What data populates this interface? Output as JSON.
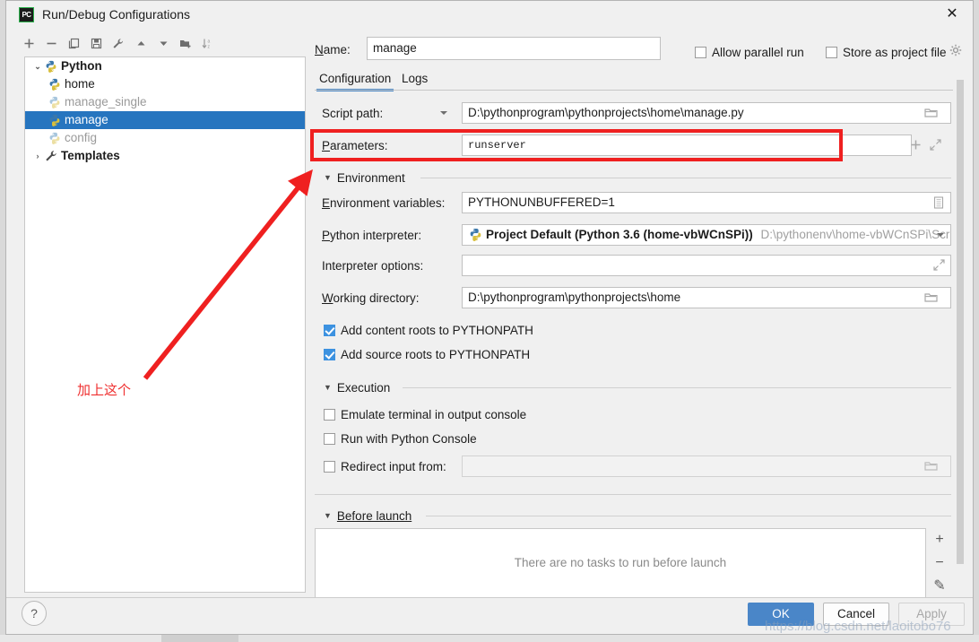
{
  "window": {
    "title": "Run/Debug Configurations",
    "app_icon": "pycharm-icon",
    "close_label": "✕"
  },
  "toolbar": {
    "items": [
      {
        "name": "add-configuration-button",
        "glyph": "+"
      },
      {
        "name": "remove-configuration-button",
        "glyph": "−"
      },
      {
        "name": "copy-configuration-button",
        "glyph": "copy-icon"
      },
      {
        "name": "save-configuration-button",
        "glyph": "save-icon"
      },
      {
        "name": "edit-templates-button",
        "glyph": "wrench-icon"
      },
      {
        "name": "move-up-button",
        "glyph": "▲"
      },
      {
        "name": "move-down-button",
        "glyph": "▼"
      },
      {
        "name": "move-into-folder-button",
        "glyph": "folder-add-icon"
      },
      {
        "name": "sort-configurations-button",
        "glyph": "sort-az-icon"
      }
    ]
  },
  "tree": {
    "nodes": [
      {
        "label": "Python",
        "indent": 0,
        "twisty": "⌄",
        "icon": "python-icon",
        "bold": true,
        "dim": false,
        "selected": false
      },
      {
        "label": "home",
        "indent": 1,
        "twisty": "",
        "icon": "python-icon",
        "bold": false,
        "dim": false,
        "selected": false
      },
      {
        "label": "manage_single",
        "indent": 1,
        "twisty": "",
        "icon": "python-icon",
        "bold": false,
        "dim": true,
        "selected": false
      },
      {
        "label": "manage",
        "indent": 1,
        "twisty": "",
        "icon": "python-icon",
        "bold": false,
        "dim": false,
        "selected": true
      },
      {
        "label": "config",
        "indent": 1,
        "twisty": "",
        "icon": "python-icon",
        "bold": false,
        "dim": true,
        "selected": false
      },
      {
        "label": "Templates",
        "indent": 0,
        "twisty": "›",
        "icon": "wrench-icon",
        "bold": true,
        "dim": false,
        "selected": false
      }
    ]
  },
  "form": {
    "name_label": "Name:",
    "name_value": "manage",
    "allow_parallel_run": {
      "label": "Allow parallel run",
      "checked": false
    },
    "store_as_project_file": {
      "label": "Store as project file",
      "checked": false
    },
    "gear_icon": "gear-icon",
    "tabs": [
      {
        "label": "Configuration",
        "active": true
      },
      {
        "label": "Logs",
        "active": false
      }
    ],
    "script_path_label": "Script path:",
    "script_path_value": "D:\\pythonprogram\\pythonprojects\\home\\manage.py",
    "parameters_label": "Parameters:",
    "parameters_value": "runserver",
    "environment_section": "Environment",
    "env_vars_label": "Environment variables:",
    "env_vars_value": "PYTHONUNBUFFERED=1",
    "interpreter_label": "Python interpreter:",
    "interpreter_value": "Project Default (Python 3.6 (home-vbWCnSPi))",
    "interpreter_path": "D:\\pythonenv\\home-vbWCnSPi\\Scripts\\py",
    "interpreter_options_label": "Interpreter options:",
    "interpreter_options_value": "",
    "working_dir_label": "Working directory:",
    "working_dir_value": "D:\\pythonprogram\\pythonprojects\\home",
    "add_content_roots": {
      "label": "Add content roots to PYTHONPATH",
      "checked": true
    },
    "add_source_roots": {
      "label": "Add source roots to PYTHONPATH",
      "checked": true
    },
    "execution_section": "Execution",
    "emulate_terminal": {
      "label": "Emulate terminal in output console",
      "checked": false
    },
    "run_with_console": {
      "label": "Run with Python Console",
      "checked": false
    },
    "redirect_input": {
      "label": "Redirect input from:",
      "checked": false,
      "value": ""
    },
    "before_launch_section": "Before launch",
    "before_launch_empty": "There are no tasks to run before launch",
    "before_launch_buttons": [
      {
        "name": "before-launch-add-button",
        "glyph": "+"
      },
      {
        "name": "before-launch-remove-button",
        "glyph": "−"
      },
      {
        "name": "before-launch-edit-button",
        "glyph": "✎"
      }
    ]
  },
  "footer": {
    "help_label": "?",
    "ok_label": "OK",
    "cancel_label": "Cancel",
    "apply_label": "Apply"
  },
  "annotations": {
    "note_text": "加上这个",
    "highlight_color": "#ef2020",
    "watermark": "https://blog.csdn.net/laoitobo76"
  }
}
